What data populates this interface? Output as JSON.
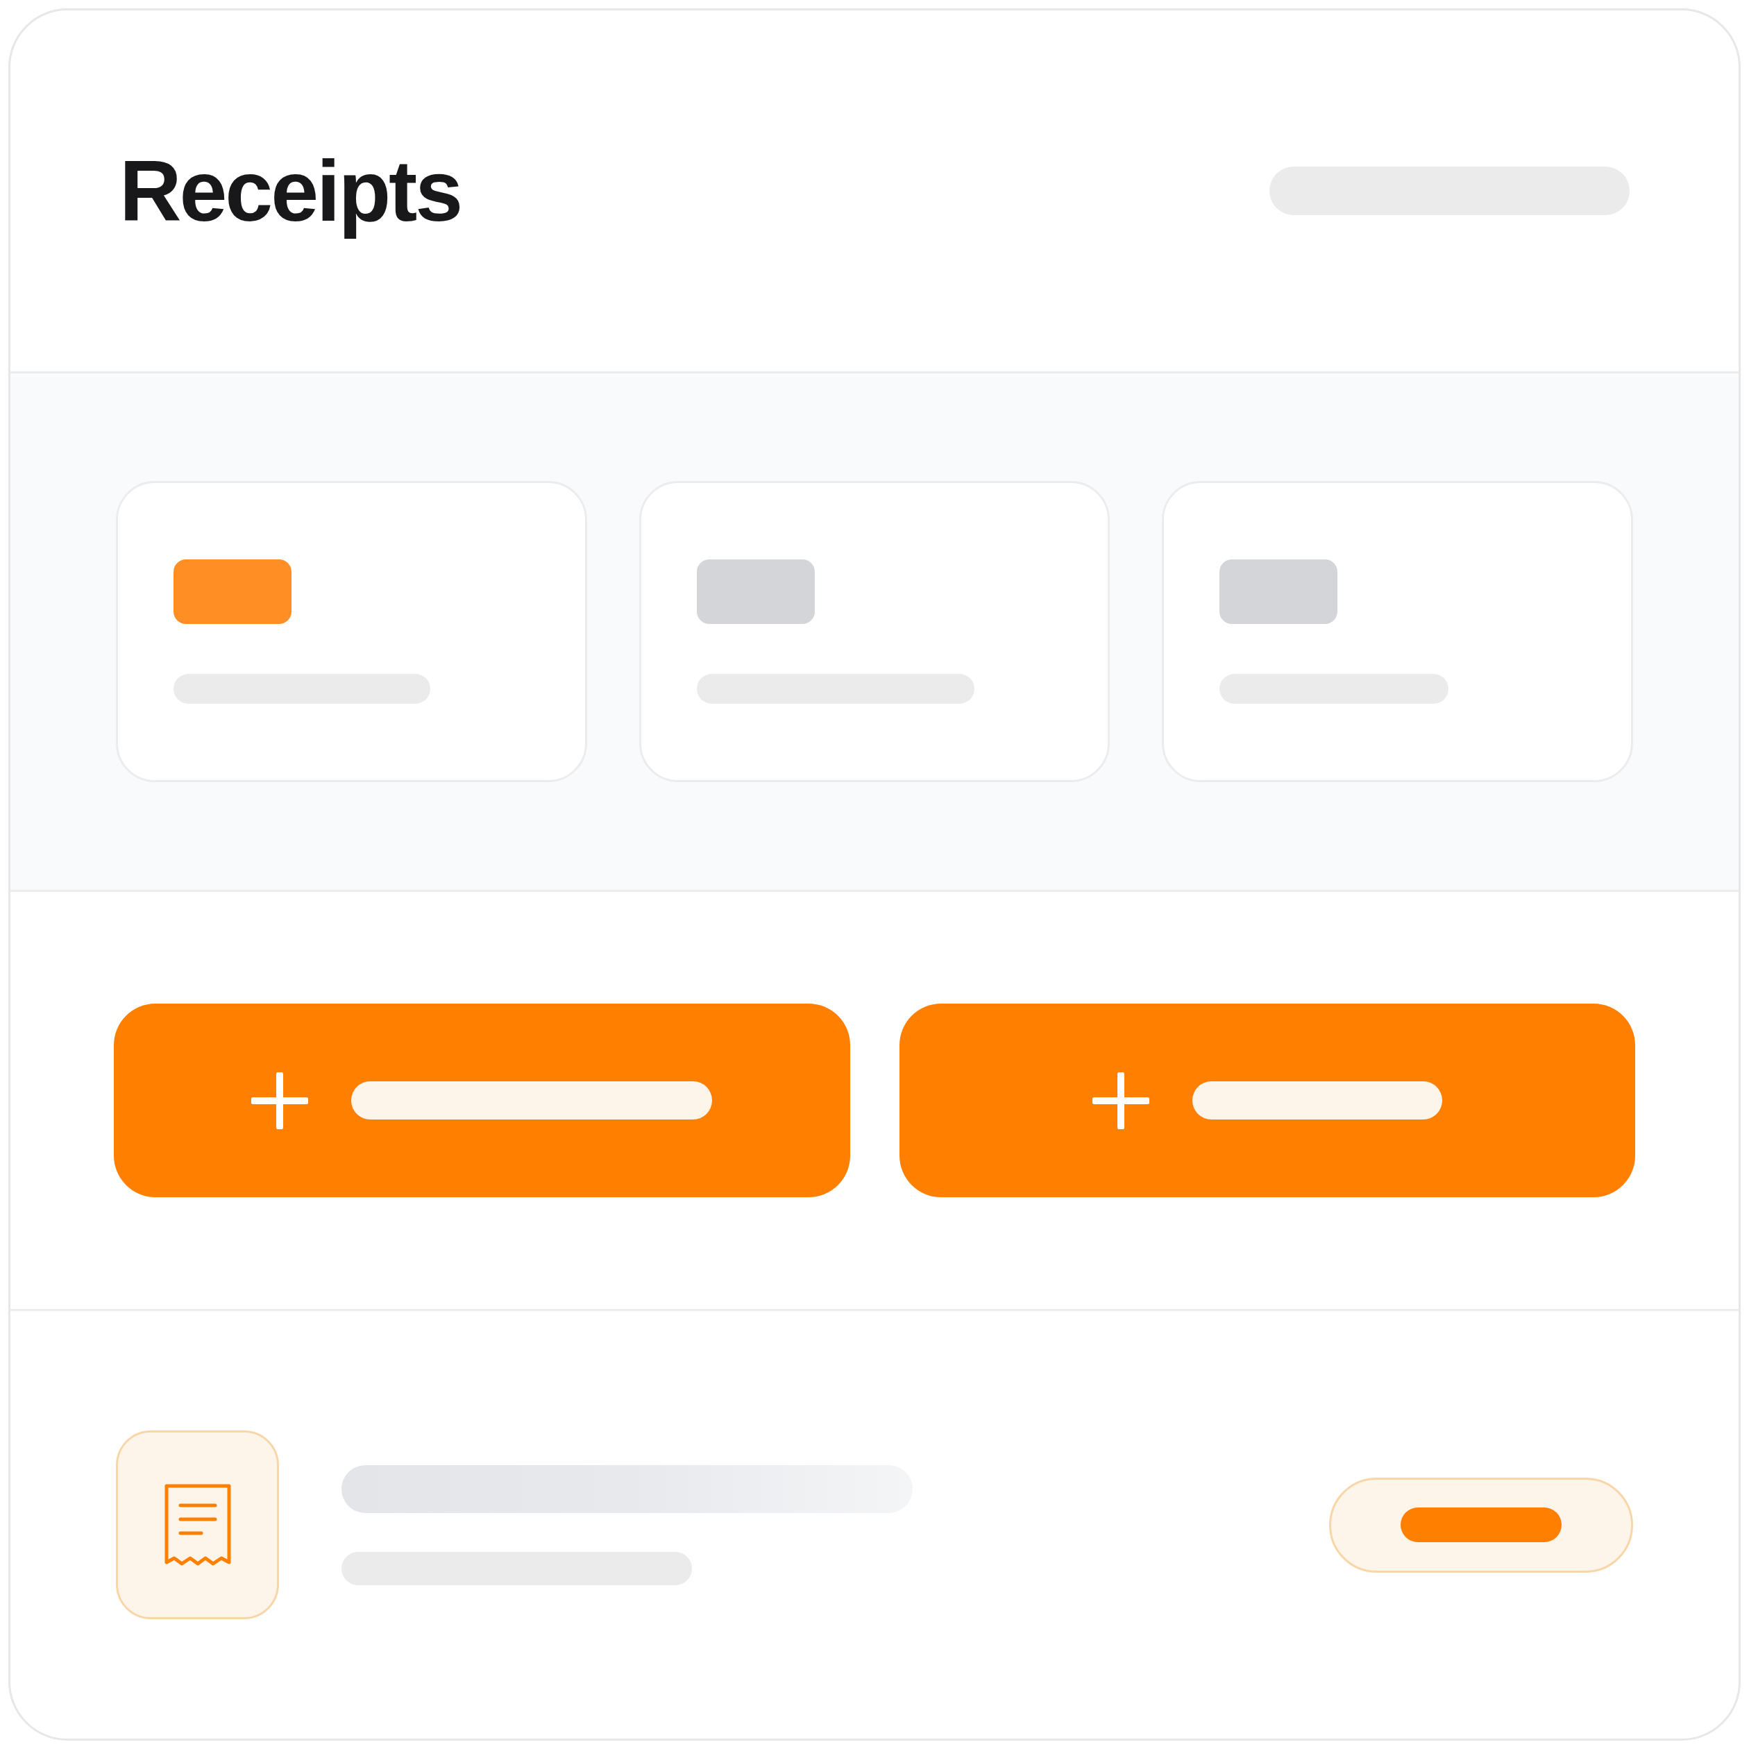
{
  "header": {
    "title": "Receipts"
  },
  "stat_cards": [
    {
      "selected": true
    },
    {
      "selected": false
    },
    {
      "selected": false
    }
  ]
}
